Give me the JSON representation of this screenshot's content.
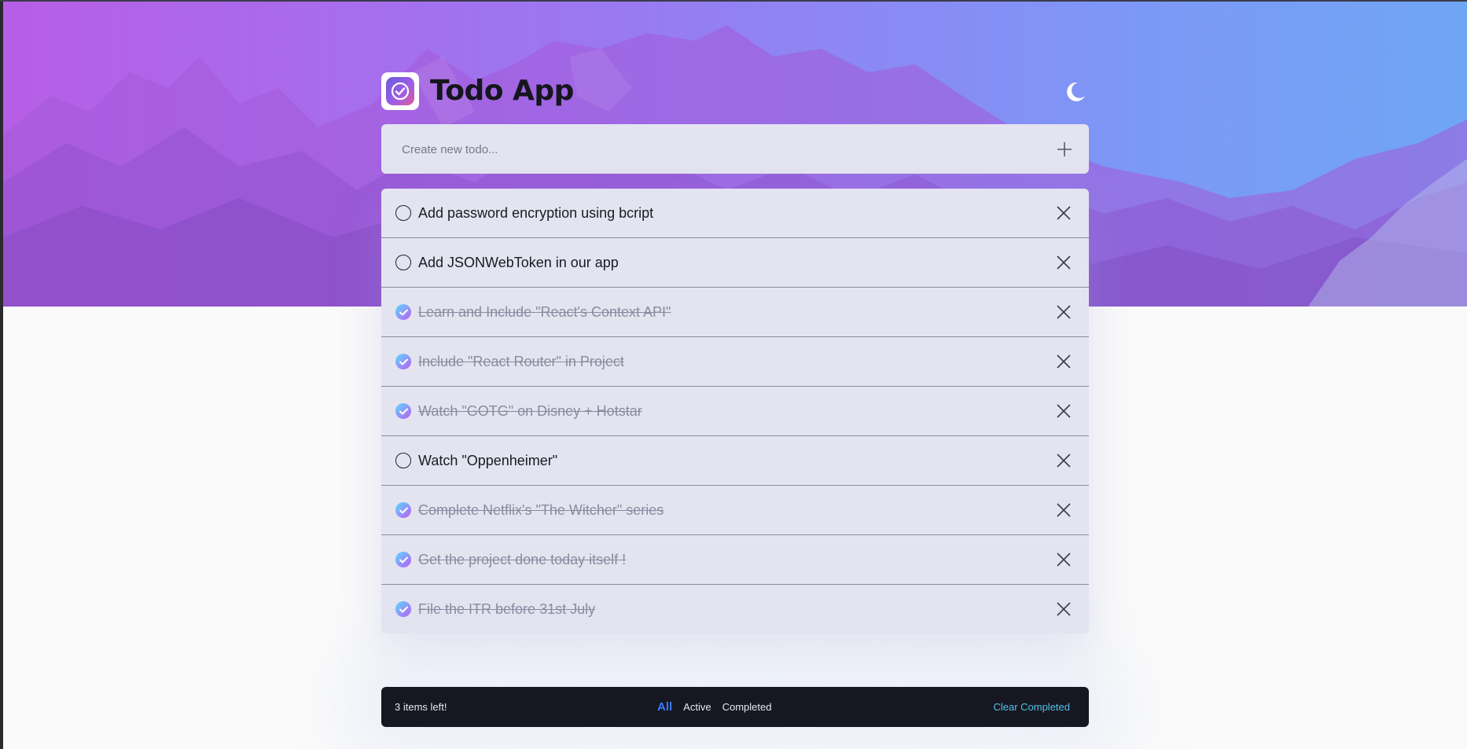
{
  "app": {
    "title": "Todo App",
    "theme_icon": "moon-icon",
    "logo_icon": "checkmark-badge-icon"
  },
  "new_todo": {
    "placeholder": "Create new todo...",
    "add_icon": "plus-icon"
  },
  "todos": [
    {
      "text": "Add password encryption using bcript",
      "completed": false
    },
    {
      "text": "Add JSONWebToken in our app",
      "completed": false
    },
    {
      "text": "Learn and Include \"React's Context API\"",
      "completed": true
    },
    {
      "text": "Include \"React Router\" in Project",
      "completed": true
    },
    {
      "text": "Watch \"GOTG\" on Disney + Hotstar",
      "completed": true
    },
    {
      "text": "Watch \"Oppenheimer\"",
      "completed": false
    },
    {
      "text": "Complete Netflix's \"The Witcher\" series",
      "completed": true
    },
    {
      "text": "Get the project done today itself !",
      "completed": true
    },
    {
      "text": "File the ITR before 31st July",
      "completed": true
    }
  ],
  "footer": {
    "items_left": "3 items left!",
    "filters": [
      "All",
      "Active",
      "Completed"
    ],
    "active_filter": "All",
    "clear_label": "Clear Completed"
  },
  "colors": {
    "accent": "#3a7bfd",
    "clear": "#4fc3e8",
    "check_gradient_start": "#57ddff",
    "check_gradient_end": "#c058f3",
    "footer_bg": "#171722",
    "card_bg": "#e4e4f0"
  }
}
